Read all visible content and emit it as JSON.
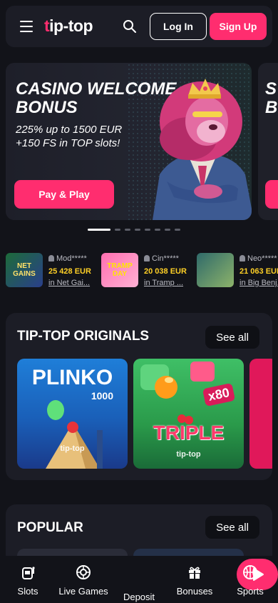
{
  "header": {
    "logo_prefix": "t",
    "logo_rest": "ip-top",
    "login_label": "Log In",
    "signup_label": "Sign Up"
  },
  "banner": {
    "title": "CASINO WELCOME BONUS",
    "subtitle": "225% up to 1500 EUR +150 FS in TOP slots!",
    "button_label": "Pay & Play",
    "next_title_peek": "S B"
  },
  "pager": {
    "count": 8,
    "active_index": 0
  },
  "winners": [
    {
      "thumb_text": "NET GAINS",
      "user": "Mod*****",
      "amount": "25 428 EUR",
      "game": "in Net Gai..."
    },
    {
      "thumb_text": "TRAMP DAY",
      "user": "Cin*****",
      "amount": "20 038 EUR",
      "game": "in Tramp ..."
    },
    {
      "thumb_text": "",
      "user": "Neo*****",
      "amount": "21 063 EUR",
      "game": "in Big Benj..."
    }
  ],
  "originals": {
    "title": "TIP-TOP ORIGINALS",
    "see_all": "See all",
    "cards": [
      {
        "name": "PLINKO",
        "sub": "1000",
        "brand": "tip-top"
      },
      {
        "name": "TRIPLE",
        "badge": "x80",
        "brand": "tip-top"
      }
    ]
  },
  "popular": {
    "title": "POPULAR",
    "see_all": "See all"
  },
  "bottom_nav": {
    "items": [
      {
        "label": "Slots",
        "icon": "slot-machine-icon"
      },
      {
        "label": "Live Games",
        "icon": "roulette-icon"
      },
      {
        "label": "Deposit",
        "icon": "play-icon"
      },
      {
        "label": "Bonuses",
        "icon": "gift-icon"
      },
      {
        "label": "Sports",
        "icon": "basketball-icon"
      }
    ]
  },
  "colors": {
    "accent": "#ff2d6f",
    "background": "#121319",
    "panel": "#1c1d26",
    "amount": "#ffd026"
  }
}
